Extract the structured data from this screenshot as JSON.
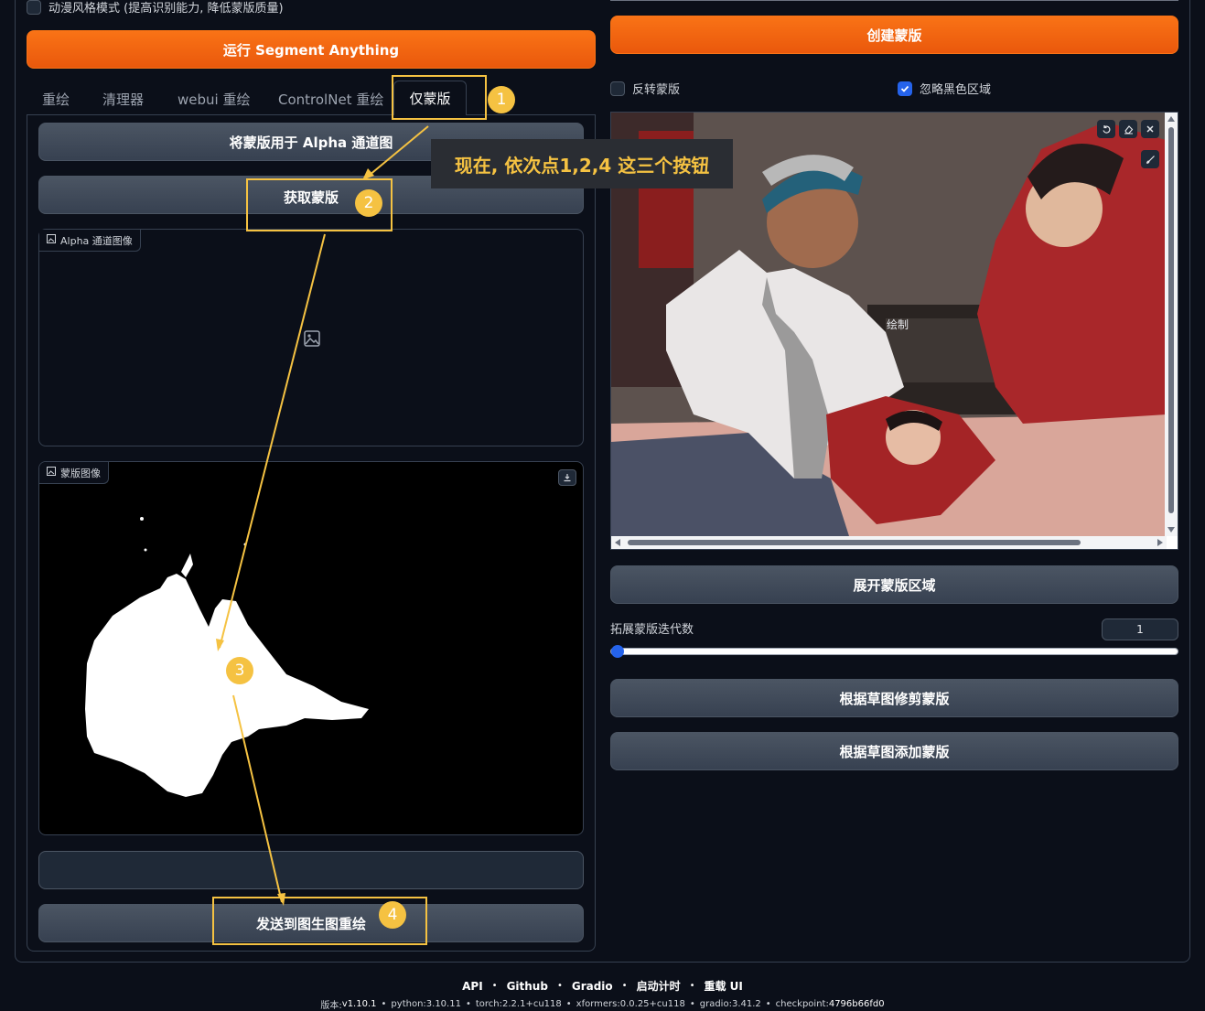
{
  "top": {
    "anime_mode_label": "动漫风格模式 (提高识别能力, 降低蒙版质量)"
  },
  "left": {
    "run_button": "运行 Segment Anything",
    "tabs": [
      "重绘",
      "清理器",
      "webui 重绘",
      "ControlNet 重绘",
      "仅蒙版"
    ],
    "alpha_button": "将蒙版用于 Alpha 通道图",
    "get_mask_button": "获取蒙版",
    "alpha_image_label": "Alpha 通道图像",
    "mask_image_label": "蒙版图像",
    "send_button": "发送到图生图重绘"
  },
  "right": {
    "create_mask_button": "创建蒙版",
    "invert_mask_label": "反转蒙版",
    "ignore_black_label": "忽略黑色区域",
    "ignore_black_checked": true,
    "image_overlay_text": "绘制",
    "expand_button": "展开蒙版区域",
    "iterations_label": "拓展蒙版迭代数",
    "iterations_value": "1",
    "iterations_slider": 0,
    "trim_button": "根据草图修剪蒙版",
    "add_button": "根据草图添加蒙版"
  },
  "annotation": {
    "callout": "现在, 依次点1,2,4 这三个按钮",
    "badges": [
      "1",
      "2",
      "3",
      "4"
    ]
  },
  "footer": {
    "links": [
      "API",
      "Github",
      "Gradio",
      "启动计时",
      "重载 UI"
    ],
    "version_line": {
      "version_label": "版本: ",
      "version": "v1.10.1",
      "python_label": "python: ",
      "python": "3.10.11",
      "torch_label": "torch: ",
      "torch": "2.2.1+cu118",
      "xformers_label": "xformers: ",
      "xformers": "0.0.25+cu118",
      "gradio_label": "gradio: ",
      "gradio": "3.41.2",
      "checkpoint_label": "checkpoint: ",
      "checkpoint": "4796b66fd0"
    }
  },
  "colors": {
    "accent_orange": "#f97316",
    "annotation_yellow": "#f5c242",
    "checkbox_blue": "#2563eb"
  }
}
